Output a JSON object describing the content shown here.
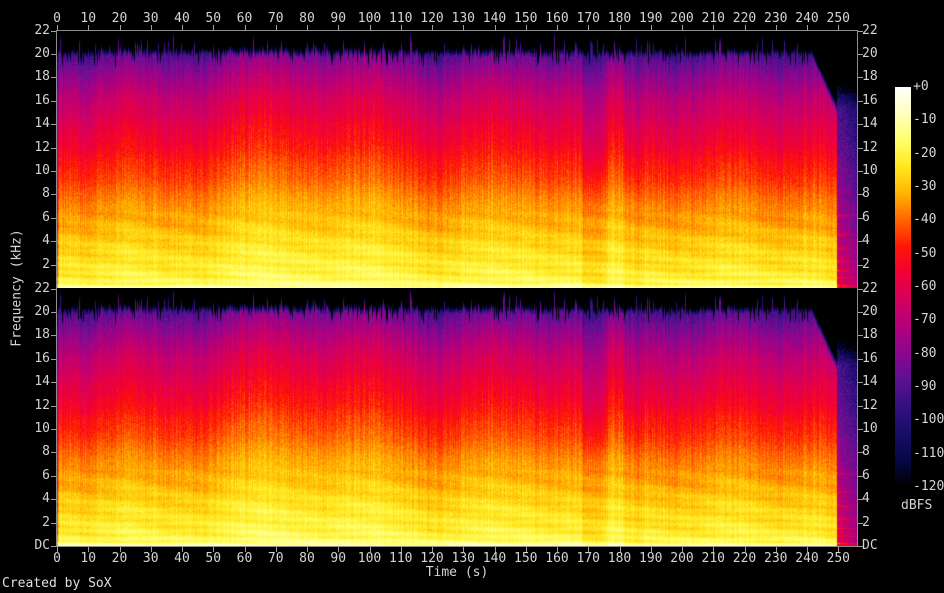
{
  "meta": {
    "credit": "Created by SoX"
  },
  "axes_colors": {
    "line": "#8e8e8e",
    "text": "#d4d4d4"
  },
  "chart_data": {
    "type": "heatmap",
    "subtype": "audio-spectrogram-stereo",
    "title": "",
    "xlabel": "Time (s)",
    "ylabel": "Frequency (kHz)",
    "channels": 2,
    "x_ticks": [
      0,
      10,
      20,
      30,
      40,
      50,
      60,
      70,
      80,
      90,
      100,
      110,
      120,
      130,
      140,
      150,
      160,
      170,
      180,
      190,
      200,
      210,
      220,
      230,
      240,
      250
    ],
    "x_range_s": [
      0,
      256
    ],
    "y_ticks_khz": [
      22,
      20,
      18,
      16,
      14,
      12,
      10,
      8,
      6,
      4,
      2
    ],
    "dc_label": "DC",
    "y_range_khz": [
      0,
      22.05
    ],
    "grid": false,
    "colorbar": {
      "label": "dBFS",
      "tick_labels": [
        "+0",
        "-10",
        "-20",
        "-30",
        "-40",
        "-50",
        "-60",
        "-70",
        "-80",
        "-90",
        "-100",
        "-110",
        "-120"
      ],
      "range_db": [
        0,
        -120
      ],
      "palette_stops": [
        {
          "db": 0,
          "color": "#ffffff"
        },
        {
          "db": -8,
          "color": "#ffffc0"
        },
        {
          "db": -16,
          "color": "#ffff6a"
        },
        {
          "db": -24,
          "color": "#ffe81e"
        },
        {
          "db": -32,
          "color": "#ffb400"
        },
        {
          "db": -40,
          "color": "#ff6400"
        },
        {
          "db": -48,
          "color": "#ff1606"
        },
        {
          "db": -56,
          "color": "#f00038"
        },
        {
          "db": -64,
          "color": "#d30060"
        },
        {
          "db": -72,
          "color": "#b2007c"
        },
        {
          "db": -80,
          "color": "#8a0890"
        },
        {
          "db": -88,
          "color": "#5c1092"
        },
        {
          "db": -96,
          "color": "#321080"
        },
        {
          "db": -104,
          "color": "#180d66"
        },
        {
          "db": -112,
          "color": "#060744"
        },
        {
          "db": -120,
          "color": "#000000"
        }
      ]
    },
    "content": {
      "spectral_envelope_db_by_khz": [
        [
          0,
          -13
        ],
        [
          0.25,
          -15
        ],
        [
          0.8,
          -19
        ],
        [
          1.5,
          -21
        ],
        [
          2.5,
          -23
        ],
        [
          3.5,
          -25
        ],
        [
          4.5,
          -28
        ],
        [
          6,
          -32
        ],
        [
          7,
          -34
        ],
        [
          8,
          -37
        ],
        [
          9,
          -41
        ],
        [
          10,
          -44
        ],
        [
          11,
          -47
        ],
        [
          12,
          -51
        ],
        [
          13,
          -54
        ],
        [
          14,
          -57
        ],
        [
          15,
          -61
        ],
        [
          16,
          -64
        ],
        [
          17,
          -69
        ],
        [
          18,
          -74
        ],
        [
          19,
          -80
        ],
        [
          19.6,
          -84
        ],
        [
          20.5,
          -87
        ],
        [
          22,
          -89
        ]
      ],
      "texture": {
        "pixel_noise_db": 3.2,
        "column_noise_db": 2.8,
        "band_spacing_khz": 0.62,
        "band_depth_db": 2.6,
        "content_top_khz": 19.9
      },
      "events": {
        "attack_end_s": 0.7,
        "quiet_dips": [
          {
            "from_s": 168.5,
            "to_s": 175.5,
            "depth_db": 6,
            "extra_hf_db": 5
          },
          {
            "from_s": 182.0,
            "to_s": 187.0,
            "depth_db": 4,
            "extra_hf_db": 3
          }
        ],
        "fade_start_s": 241.5,
        "fade_cap_khz_per_s": 0.62,
        "tail_start_s": 249.5,
        "tail_lines_khz": [
          0.25,
          0.85,
          1.5,
          2.3,
          3.4,
          4.6,
          6.2
        ]
      },
      "seeds": {
        "structure": 42,
        "channels": [
          101,
          202
        ]
      }
    }
  }
}
